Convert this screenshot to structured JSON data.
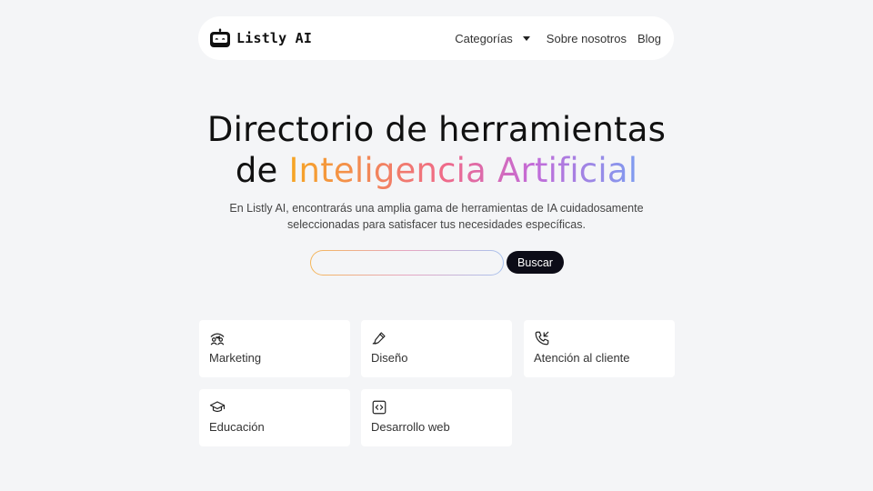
{
  "header": {
    "brand": "Listly AI",
    "nav": {
      "categories": "Categorías",
      "about": "Sobre nosotros",
      "blog": "Blog"
    }
  },
  "hero": {
    "title_line1": "Directorio de herramientas",
    "title_line2_prefix": "de ",
    "title_line2_highlight": "Inteligencia Artificial",
    "description_line1": "En Listly AI, encontrarás una amplia gama de herramientas de IA cuidadosamente",
    "description_line2": "seleccionadas para satisfacer tus necesidades específicas."
  },
  "search": {
    "placeholder": "",
    "value": "",
    "button_label": "Buscar"
  },
  "categories": [
    {
      "label": "Marketing",
      "icon": "users-megaphone-icon"
    },
    {
      "label": "Diseño",
      "icon": "pen-icon"
    },
    {
      "label": "Atención al cliente",
      "icon": "phone-incoming-icon"
    },
    {
      "label": "Educación",
      "icon": "graduation-cap-icon"
    },
    {
      "label": "Desarrollo web",
      "icon": "code-icon"
    }
  ],
  "colors": {
    "page_background": "#f4f5f7",
    "search_button": "#0c0c17",
    "gradient": [
      "#f6a623",
      "#ef6a8a",
      "#c36bd8",
      "#7e9cf0"
    ]
  }
}
